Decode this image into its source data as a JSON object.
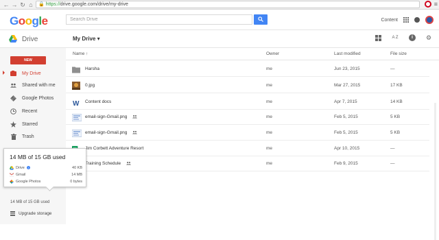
{
  "browser": {
    "url_https": "https://",
    "url_rest": "drive.google.com/drive/my-drive"
  },
  "header": {
    "logo_letters": [
      "G",
      "o",
      "o",
      "g",
      "l",
      "e"
    ],
    "search_placeholder": "Search Drive",
    "content_link": "Content"
  },
  "drivebar": {
    "app_name": "Drive",
    "location": "My Drive ▾",
    "sort_icon_text": "A Z"
  },
  "sidebar": {
    "new_label": "NEW",
    "items": [
      {
        "label": "My Drive",
        "icon": "my-drive-icon",
        "active": true
      },
      {
        "label": "Shared with me",
        "icon": "people-icon"
      },
      {
        "label": "Google Photos",
        "icon": "photos-icon"
      },
      {
        "label": "Recent",
        "icon": "clock-icon"
      },
      {
        "label": "Starred",
        "icon": "star-icon"
      },
      {
        "label": "Trash",
        "icon": "trash-icon"
      }
    ],
    "storage_text": "14 MB of 15 GB used",
    "upgrade_label": "Upgrade storage"
  },
  "storage_popup": {
    "title": "14 MB of 15 GB used",
    "rows": [
      {
        "label": "Drive",
        "value": "40 KB",
        "icon": "drive-icon",
        "info": "i"
      },
      {
        "label": "Gmail",
        "value": "14 MB",
        "icon": "gmail-icon"
      },
      {
        "label": "Google Photos",
        "value": "0 bytes",
        "icon": "photos-icon"
      }
    ]
  },
  "table": {
    "columns": {
      "name": "Name ↑",
      "owner": "Owner",
      "modified": "Last modified",
      "size": "File size"
    },
    "rows": [
      {
        "name": "Harsha",
        "type": "folder",
        "owner": "me",
        "modified": "Jun 23, 2015",
        "size": "—"
      },
      {
        "name": "0.jpg",
        "type": "image",
        "owner": "me",
        "modified": "Mar 27, 2015",
        "size": "17 KB"
      },
      {
        "name": "Content docs",
        "type": "word",
        "owner": "me",
        "modified": "Apr 7, 2015",
        "size": "14 KB"
      },
      {
        "name": "email-sign-Gmail.png",
        "type": "png",
        "shared": true,
        "owner": "me",
        "modified": "Feb 5, 2015",
        "size": "5 KB"
      },
      {
        "name": "email-sign-Gmail.png",
        "type": "png",
        "shared": true,
        "owner": "me",
        "modified": "Feb 5, 2015",
        "size": "5 KB"
      },
      {
        "name": "Jim Corbett Adventure Resort",
        "type": "sheet",
        "owner": "me",
        "modified": "Apr 10, 2015",
        "size": "—"
      },
      {
        "name": "Training Schedule",
        "type": "doc",
        "shared": true,
        "owner": "me",
        "modified": "Feb 9, 2015",
        "size": "—"
      }
    ]
  },
  "colors": {
    "brand_red": "#d23f31",
    "search_blue": "#4285f4",
    "sidebar_bg": "#f6f6f6"
  }
}
